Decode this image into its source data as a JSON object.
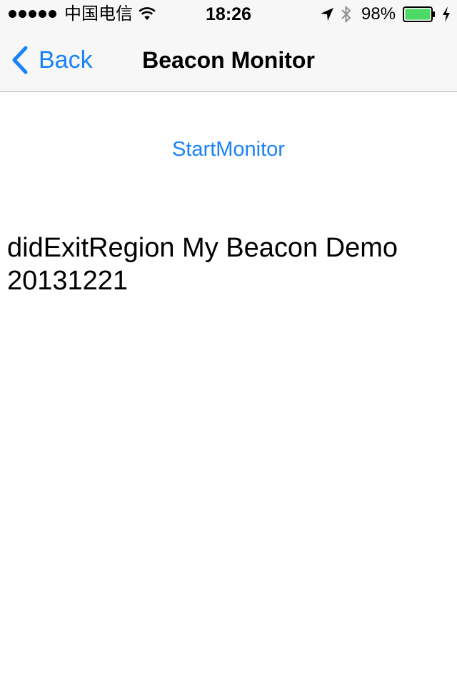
{
  "status_bar": {
    "carrier": "中国电信",
    "time": "18:26",
    "battery_percent": "98%",
    "signal_bars": 5,
    "icons": [
      "signal-dots-icon",
      "wifi-icon",
      "location-arrow-icon",
      "bluetooth-icon",
      "battery-icon",
      "charging-bolt-icon"
    ]
  },
  "nav": {
    "back_label": "Back",
    "title": "Beacon Monitor"
  },
  "main": {
    "start_button_label": "StartMonitor",
    "status_text": "didExitRegion My Beacon Demo\n20131221"
  },
  "colors": {
    "tint": "#1a82f7",
    "bar_background": "#f7f7f7",
    "battery_fill": "#4cd964"
  }
}
